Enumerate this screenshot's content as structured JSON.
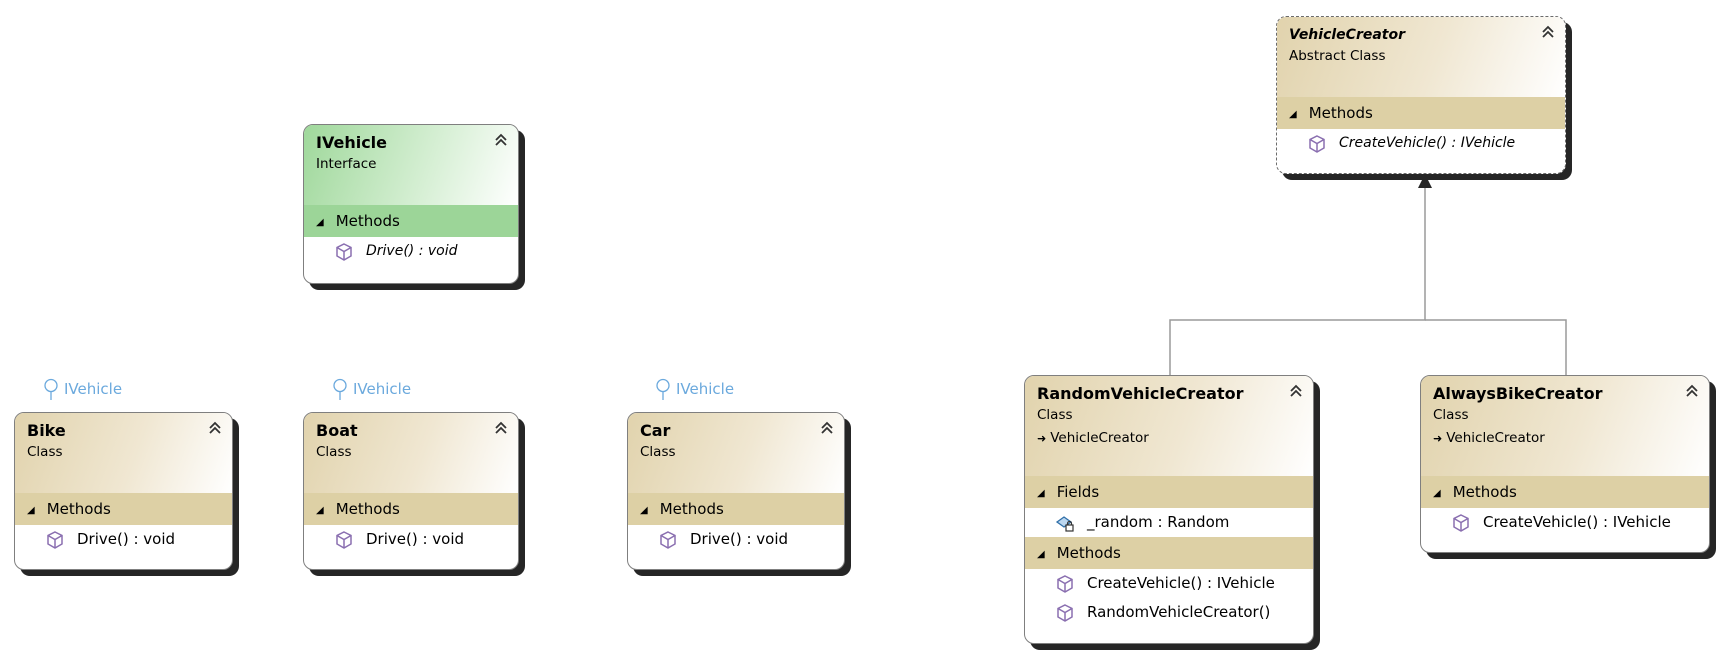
{
  "classes": {
    "vehicle_creator": {
      "name": "VehicleCreator",
      "kind": "Abstract Class",
      "section": "Methods",
      "methods": [
        "CreateVehicle() : IVehicle"
      ]
    },
    "ivehicle": {
      "name": "IVehicle",
      "kind": "Interface",
      "section": "Methods",
      "methods": [
        "Drive() : void"
      ]
    },
    "bike": {
      "name": "Bike",
      "kind": "Class",
      "implements": "IVehicle",
      "section": "Methods",
      "methods": [
        "Drive() : void"
      ]
    },
    "boat": {
      "name": "Boat",
      "kind": "Class",
      "implements": "IVehicle",
      "section": "Methods",
      "methods": [
        "Drive() : void"
      ]
    },
    "car": {
      "name": "Car",
      "kind": "Class",
      "implements": "IVehicle",
      "section": "Methods",
      "methods": [
        "Drive() : void"
      ]
    },
    "random_vehicle_creator": {
      "name": "RandomVehicleCreator",
      "kind": "Class",
      "base": "VehicleCreator",
      "fields_section": "Fields",
      "fields": [
        "_random : Random"
      ],
      "section": "Methods",
      "methods": [
        "CreateVehicle() : IVehicle",
        "RandomVehicleCreator()"
      ]
    },
    "always_bike_creator": {
      "name": "AlwaysBikeCreator",
      "kind": "Class",
      "base": "VehicleCreator",
      "section": "Methods",
      "methods": [
        "CreateVehicle() : IVehicle"
      ]
    }
  },
  "icons": {
    "method": "method-cube-icon",
    "field": "private-field-icon",
    "collapse": "double-chevron-up-icon",
    "interface_lollipop": "interface-lollipop-icon",
    "inheritance_arrow": "inheritance-arrow-icon"
  },
  "colors": {
    "class_header": "#ddd0a5",
    "interface_header": "#9cd598",
    "lollipop_text": "#6ba9dd",
    "method_icon": "#8a6fb0",
    "connector": "#9a9a9a"
  }
}
